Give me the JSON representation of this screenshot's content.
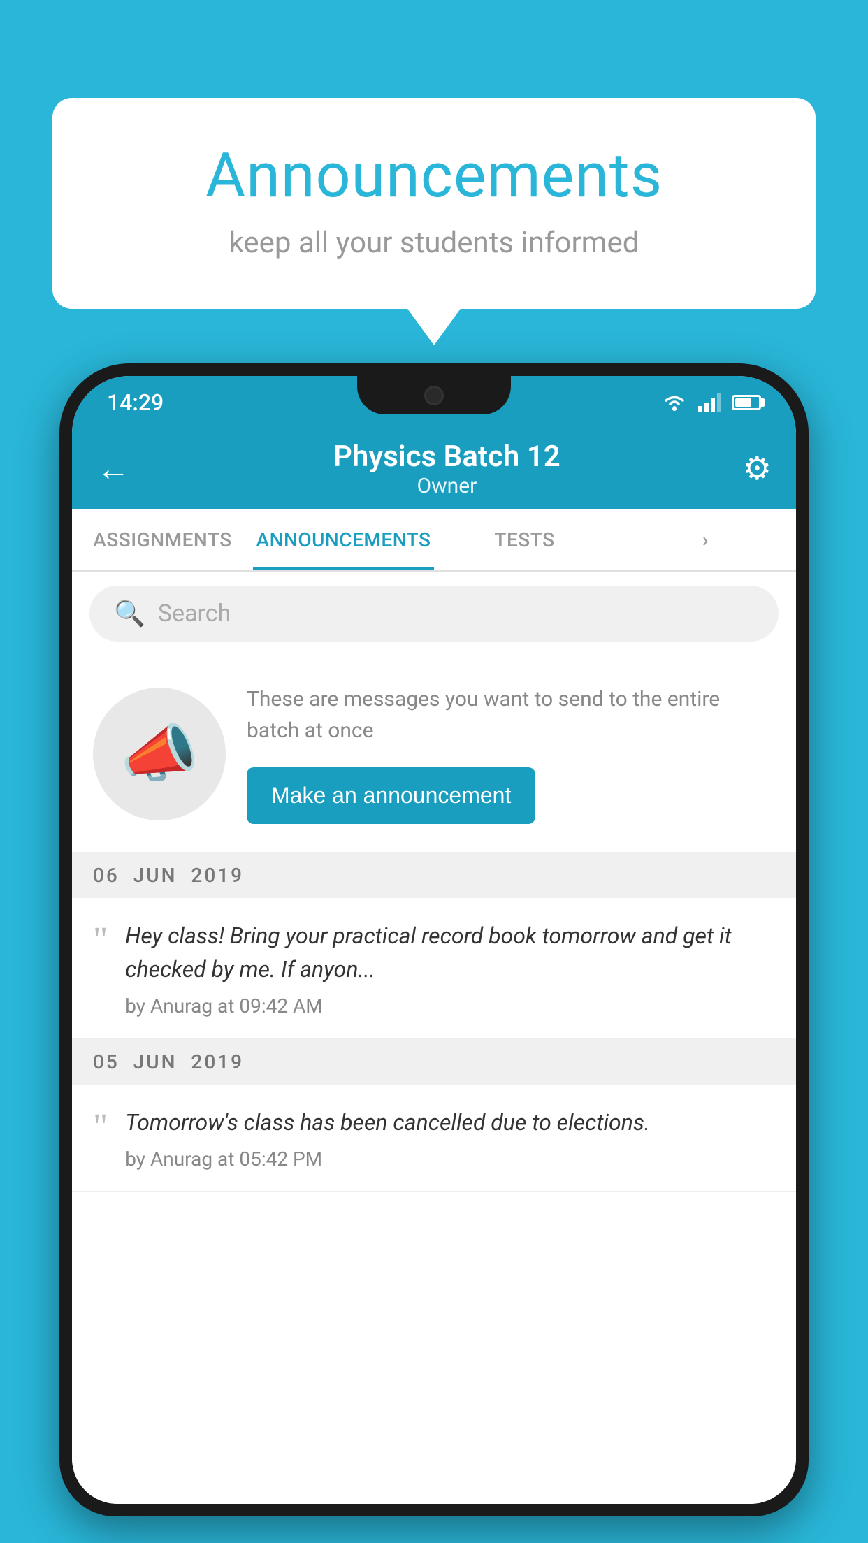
{
  "background_color": "#29b6d8",
  "speech_bubble": {
    "title": "Announcements",
    "subtitle": "keep all your students informed"
  },
  "status_bar": {
    "time": "14:29"
  },
  "app_bar": {
    "title": "Physics Batch 12",
    "subtitle": "Owner",
    "back_label": "←",
    "gear_label": "⚙"
  },
  "tabs": [
    {
      "label": "ASSIGNMENTS",
      "active": false
    },
    {
      "label": "ANNOUNCEMENTS",
      "active": true
    },
    {
      "label": "TESTS",
      "active": false
    },
    {
      "label": "•",
      "active": false
    }
  ],
  "search": {
    "placeholder": "Search"
  },
  "cta": {
    "description": "These are messages you want to send to the entire batch at once",
    "button_label": "Make an announcement"
  },
  "date_groups": [
    {
      "date": "06  JUN  2019",
      "announcements": [
        {
          "text": "Hey class! Bring your practical record book tomorrow and get it checked by me. If anyon...",
          "meta": "by Anurag at 09:42 AM"
        }
      ]
    },
    {
      "date": "05  JUN  2019",
      "announcements": [
        {
          "text": "Tomorrow's class has been cancelled due to elections.",
          "meta": "by Anurag at 05:42 PM"
        }
      ]
    }
  ]
}
